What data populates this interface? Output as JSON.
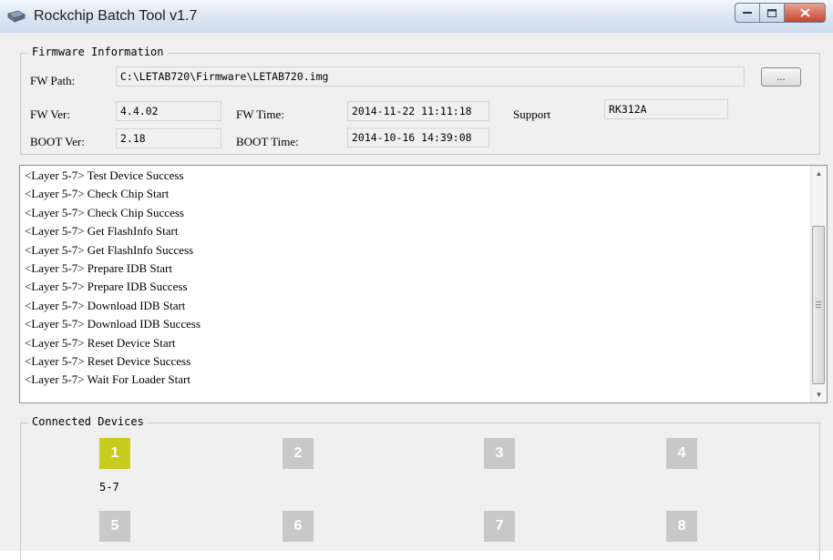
{
  "window": {
    "title": "Rockchip Batch Tool v1.7"
  },
  "firmware": {
    "group_title": "Firmware Information",
    "fw_path_label": "FW Path:",
    "fw_path_value": "C:\\LETAB720\\Firmware\\LETAB720.img",
    "browse_label": "...",
    "fw_ver_label": "FW Ver:",
    "fw_ver_value": "4.4.02",
    "fw_time_label": "FW Time:",
    "fw_time_value": "2014-11-22 11:11:18",
    "support_label": "Support",
    "support_value": "RK312A",
    "boot_ver_label": "BOOT Ver:",
    "boot_ver_value": "2.18",
    "boot_time_label": "BOOT Time:",
    "boot_time_value": "2014-10-16 14:39:08"
  },
  "log": {
    "lines": [
      "<Layer 5-7> Test Device Success",
      "<Layer 5-7> Check Chip Start",
      "<Layer 5-7> Check Chip Success",
      "<Layer 5-7> Get FlashInfo Start",
      "<Layer 5-7> Get FlashInfo Success",
      "<Layer 5-7> Prepare IDB Start",
      "<Layer 5-7> Prepare IDB Success",
      "<Layer 5-7> Download IDB Start",
      "<Layer 5-7> Download IDB Success",
      "<Layer 5-7> Reset Device Start",
      "<Layer 5-7> Reset Device Success",
      "<Layer 5-7> Wait For Loader Start"
    ]
  },
  "devices": {
    "group_title": "Connected Devices",
    "slots": [
      {
        "label": "1",
        "port": "5-7",
        "active": true
      },
      {
        "label": "2",
        "port": "",
        "active": false
      },
      {
        "label": "3",
        "port": "",
        "active": false
      },
      {
        "label": "4",
        "port": "",
        "active": false
      },
      {
        "label": "5",
        "port": "",
        "active": false
      },
      {
        "label": "6",
        "port": "",
        "active": false
      },
      {
        "label": "7",
        "port": "",
        "active": false
      },
      {
        "label": "8",
        "port": "",
        "active": false
      }
    ],
    "active_color": "#c8cc1d",
    "inactive_color": "#c8c8c8"
  }
}
